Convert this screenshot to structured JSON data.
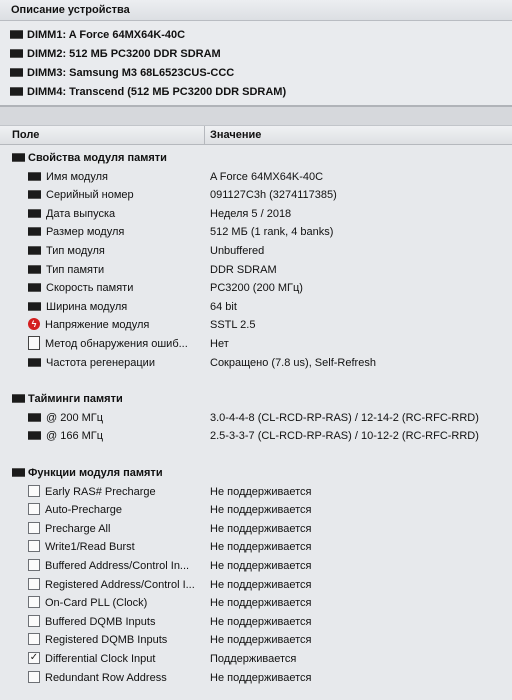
{
  "panel_title": "Описание устройства",
  "devices": [
    "DIMM1: A Force 64MX64K-40C",
    "DIMM2: 512 МБ PC3200 DDR SDRAM",
    "DIMM3: Samsung M3 68L6523CUS-CCC",
    "DIMM4: Transcend (512 МБ PC3200 DDR SDRAM)"
  ],
  "columns": {
    "field": "Поле",
    "value": "Значение"
  },
  "sections": {
    "module_props": {
      "title": "Свойства модуля памяти",
      "rows": [
        {
          "label": "Имя модуля",
          "value": "A Force 64MX64K-40C",
          "icon": "memory-chip-icon"
        },
        {
          "label": "Серийный номер",
          "value": "091127C3h (3274117385)",
          "icon": "memory-chip-icon"
        },
        {
          "label": "Дата выпуска",
          "value": "Неделя 5 / 2018",
          "icon": "memory-chip-icon"
        },
        {
          "label": "Размер модуля",
          "value": "512 МБ (1 rank, 4 banks)",
          "icon": "memory-chip-icon"
        },
        {
          "label": "Тип модуля",
          "value": "Unbuffered",
          "icon": "memory-chip-icon"
        },
        {
          "label": "Тип памяти",
          "value": "DDR SDRAM",
          "icon": "memory-chip-icon"
        },
        {
          "label": "Скорость памяти",
          "value": "PC3200 (200 МГц)",
          "icon": "memory-chip-icon"
        },
        {
          "label": "Ширина модуля",
          "value": "64 bit",
          "icon": "memory-chip-icon"
        },
        {
          "label": "Напряжение модуля",
          "value": "SSTL 2.5",
          "icon": "voltage-bolt-icon"
        },
        {
          "label": "Метод обнаружения ошиб...",
          "value": "Нет",
          "icon": "document-icon"
        },
        {
          "label": "Частота регенерации",
          "value": "Сокращено (7.8 us), Self-Refresh",
          "icon": "memory-chip-icon"
        }
      ]
    },
    "timings": {
      "title": "Тайминги памяти",
      "rows": [
        {
          "label": "@ 200 МГц",
          "value": "3.0-4-4-8  (CL-RCD-RP-RAS) / 12-14-2  (RC-RFC-RRD)"
        },
        {
          "label": "@ 166 МГц",
          "value": "2.5-3-3-7  (CL-RCD-RP-RAS) / 10-12-2  (RC-RFC-RRD)"
        }
      ]
    },
    "features": {
      "title": "Функции модуля памяти",
      "rows": [
        {
          "label": "Early RAS# Precharge",
          "value": "Не поддерживается",
          "checked": false
        },
        {
          "label": "Auto-Precharge",
          "value": "Не поддерживается",
          "checked": false
        },
        {
          "label": "Precharge All",
          "value": "Не поддерживается",
          "checked": false
        },
        {
          "label": "Write1/Read Burst",
          "value": "Не поддерживается",
          "checked": false
        },
        {
          "label": "Buffered Address/Control In...",
          "value": "Не поддерживается",
          "checked": false
        },
        {
          "label": "Registered Address/Control I...",
          "value": "Не поддерживается",
          "checked": false
        },
        {
          "label": "On-Card PLL (Clock)",
          "value": "Не поддерживается",
          "checked": false
        },
        {
          "label": "Buffered DQMB Inputs",
          "value": "Не поддерживается",
          "checked": false
        },
        {
          "label": "Registered DQMB Inputs",
          "value": "Не поддерживается",
          "checked": false
        },
        {
          "label": "Differential Clock Input",
          "value": "Поддерживается",
          "checked": true
        },
        {
          "label": "Redundant Row Address",
          "value": "Не поддерживается",
          "checked": false
        }
      ]
    }
  }
}
